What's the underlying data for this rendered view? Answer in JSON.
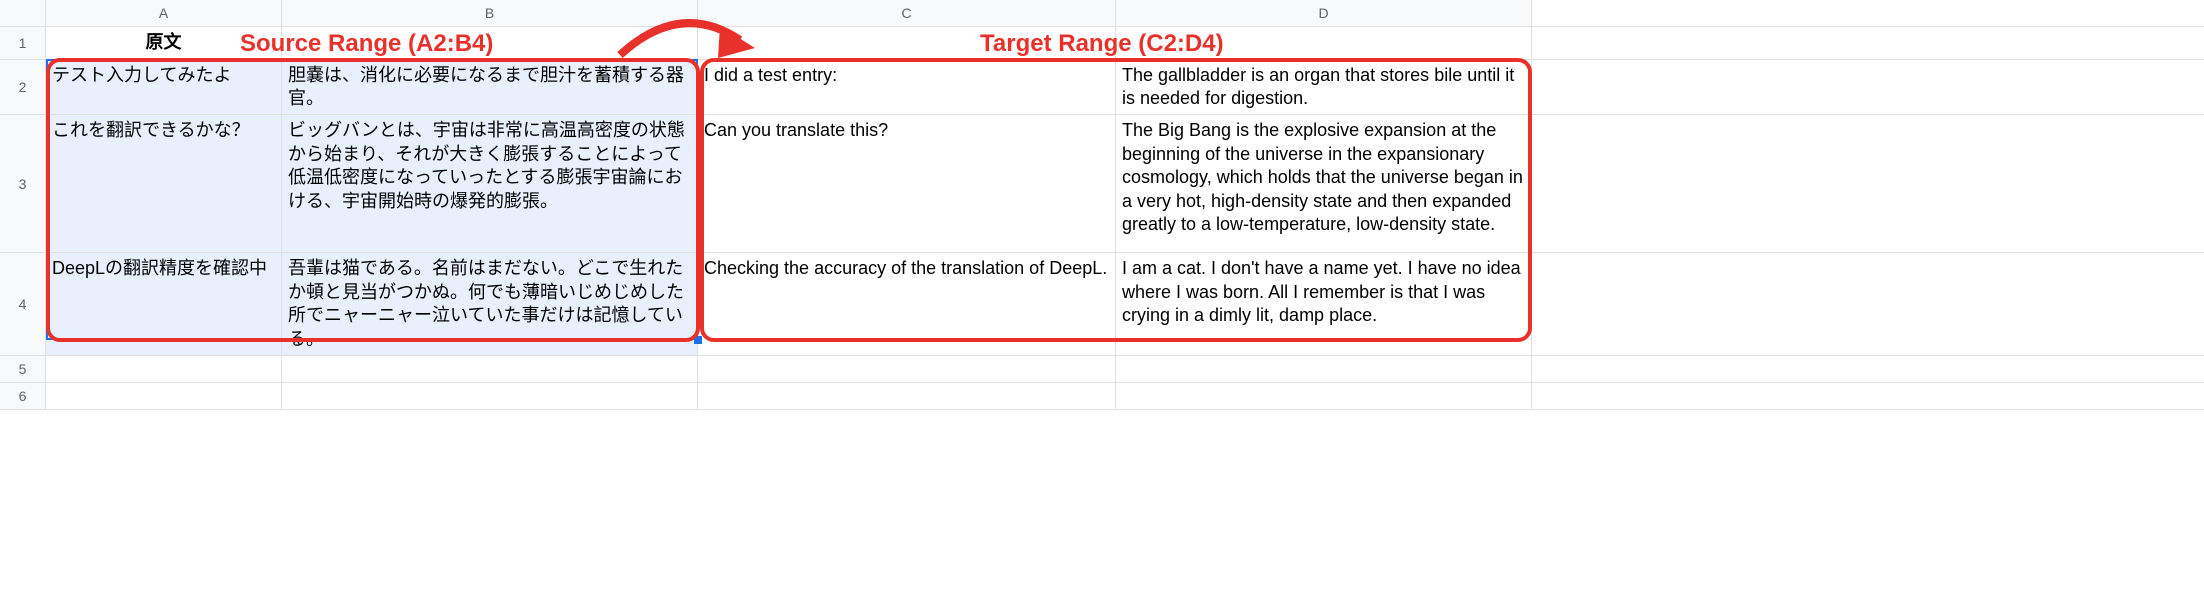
{
  "col_headers": [
    "A",
    "B",
    "C",
    "D"
  ],
  "row_headers": [
    "1",
    "2",
    "3",
    "4",
    "5",
    "6"
  ],
  "header": {
    "a1": "原文"
  },
  "annotations": {
    "source_label": "Source Range (A2:B4)",
    "target_label": "Target Range (C2:D4)"
  },
  "cells": {
    "a2": "テスト入力してみたよ",
    "b2": "胆嚢は、消化に必要になるまで胆汁を蓄積する器官。",
    "c2": "I did a test entry:",
    "d2": " The gallbladder is an organ that stores bile until it is needed for digestion.",
    "a3": "これを翻訳できるかな？",
    "b3": "ビッグバンとは、宇宙は非常に高温高密度の状態から始まり、それが大きく膨張することによって低温低密度になっていったとする膨張宇宙論における、宇宙開始時の爆発的膨張。",
    "c3": "Can you translate this?",
    "d3": "The Big Bang is the explosive expansion at the beginning of the universe in the expansionary cosmology, which holds that the universe began in a very hot, high-density state and then expanded greatly to a low-temperature, low-density state.",
    "a4": "DeepLの翻訳精度を確認中",
    "b4": "吾輩は猫である。名前はまだない。どこで生れたか頓と見当がつかぬ。何でも薄暗いじめじめした所でニャーニャー泣いていた事だけは記憶している。",
    "c4": "Checking the accuracy of the translation of DeepL.",
    "d4": " I am a cat. I don't have a name yet. I have no idea where I was born. All I remember is that I was crying in a dimly lit, damp place."
  }
}
